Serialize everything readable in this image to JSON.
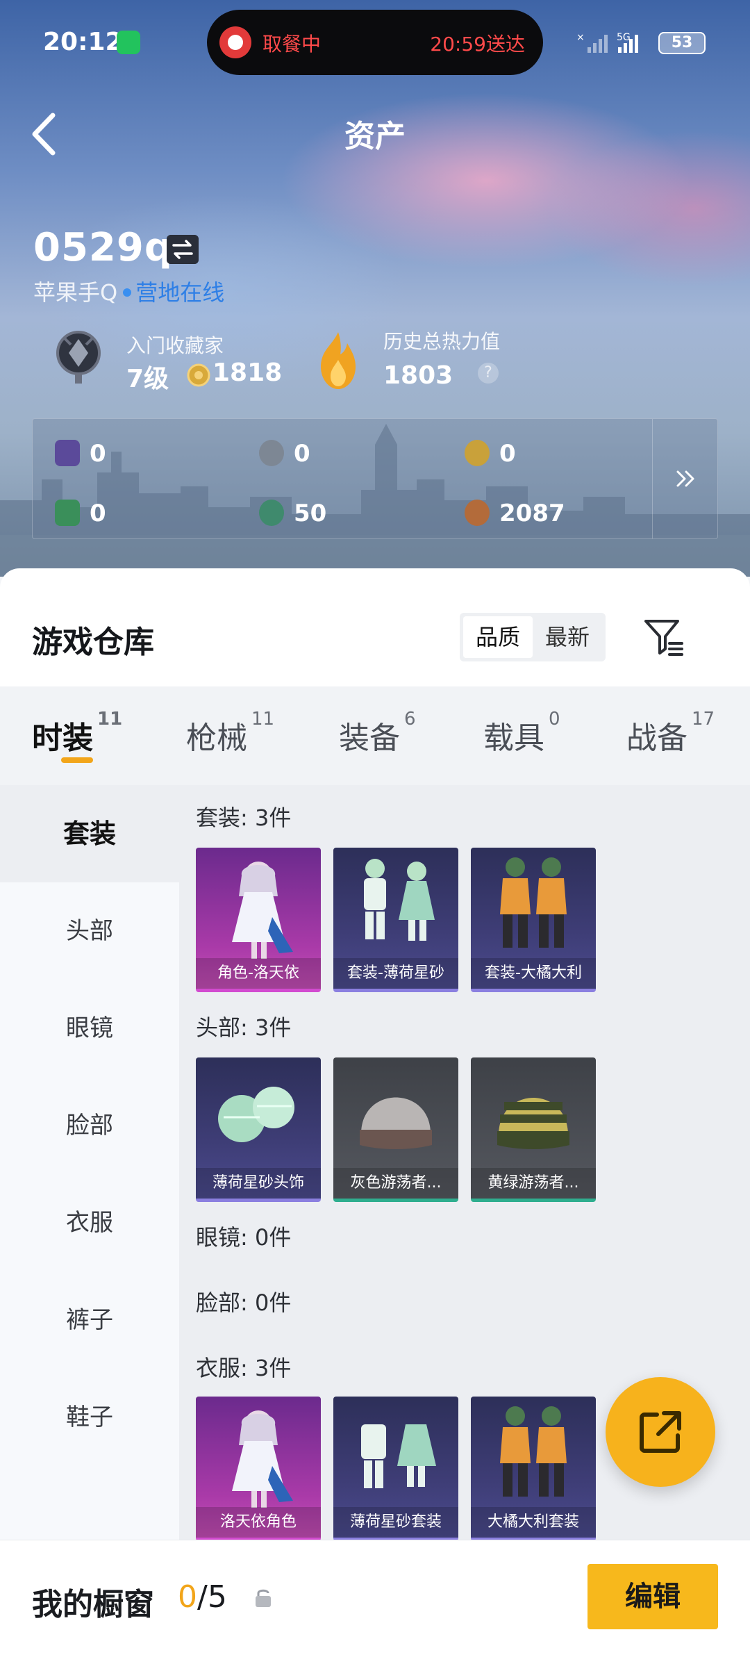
{
  "status": {
    "time": "20:12",
    "pill_left": "取餐中",
    "pill_right": "20:59送达",
    "network": "5G",
    "battery": "53"
  },
  "nav": {
    "title": "资产"
  },
  "profile": {
    "username": "0529qz",
    "platform": "苹果手Q",
    "online": "营地在线",
    "collector_title": "入门收藏家",
    "collector_level": "7级",
    "collector_points": "1818",
    "heat_title": "历史总热力值",
    "heat_value": "1803",
    "help": "?"
  },
  "currencies": [
    {
      "icon": "purple-card-icon",
      "value": "0",
      "color": "#5b4a9a"
    },
    {
      "icon": "silver-coin-icon",
      "value": "0",
      "color": "#7d8794"
    },
    {
      "icon": "gold-coin-icon",
      "value": "0",
      "color": "#c9a13a"
    },
    {
      "icon": "green-card-icon",
      "value": "0",
      "color": "#3a8f5a"
    },
    {
      "icon": "jade-coin-icon",
      "value": "50",
      "color": "#3f8a6d"
    },
    {
      "icon": "bronze-coin-icon",
      "value": "2087",
      "color": "#b36b3a"
    }
  ],
  "warehouse": {
    "title": "游戏仓库",
    "sort_options": [
      "品质",
      "最新"
    ],
    "sort_active": 0,
    "tabs": [
      {
        "label": "时装",
        "count": "11"
      },
      {
        "label": "枪械",
        "count": "11"
      },
      {
        "label": "装备",
        "count": "6"
      },
      {
        "label": "载具",
        "count": "0"
      },
      {
        "label": "战备",
        "count": "17"
      }
    ],
    "active_tab": 0,
    "sidebar": [
      "套装",
      "头部",
      "眼镜",
      "脸部",
      "衣服",
      "裤子",
      "鞋子"
    ],
    "active_sidebar": 0,
    "sections": [
      {
        "label": "套装: 3件",
        "items": [
          {
            "name": "角色-洛天依",
            "rarity": "purple",
            "art": "girl"
          },
          {
            "name": "套装-薄荷星砂",
            "rarity": "violet",
            "art": "outfit-mint"
          },
          {
            "name": "套装-大橘大利",
            "rarity": "violet",
            "art": "outfit-orange"
          }
        ]
      },
      {
        "label": "头部: 3件",
        "items": [
          {
            "name": "薄荷星砂头饰",
            "rarity": "violet",
            "art": "headpiece"
          },
          {
            "name": "灰色游荡者...",
            "rarity": "gray",
            "art": "beanie-gray"
          },
          {
            "name": "黄绿游荡者...",
            "rarity": "gray",
            "art": "beanie-green"
          }
        ]
      },
      {
        "label": "眼镜: 0件",
        "items": []
      },
      {
        "label": "脸部: 0件",
        "items": []
      },
      {
        "label": "衣服: 3件",
        "items": [
          {
            "name": "洛天依角色",
            "rarity": "purple",
            "art": "girl"
          },
          {
            "name": "薄荷星砂套装",
            "rarity": "violet",
            "art": "outfit-mint"
          },
          {
            "name": "大橘大利套装",
            "rarity": "violet",
            "art": "outfit-orange"
          }
        ]
      }
    ]
  },
  "showcase": {
    "label": "我的橱窗",
    "current": "0",
    "separator": "/",
    "max": "5",
    "edit_label": "编辑"
  }
}
